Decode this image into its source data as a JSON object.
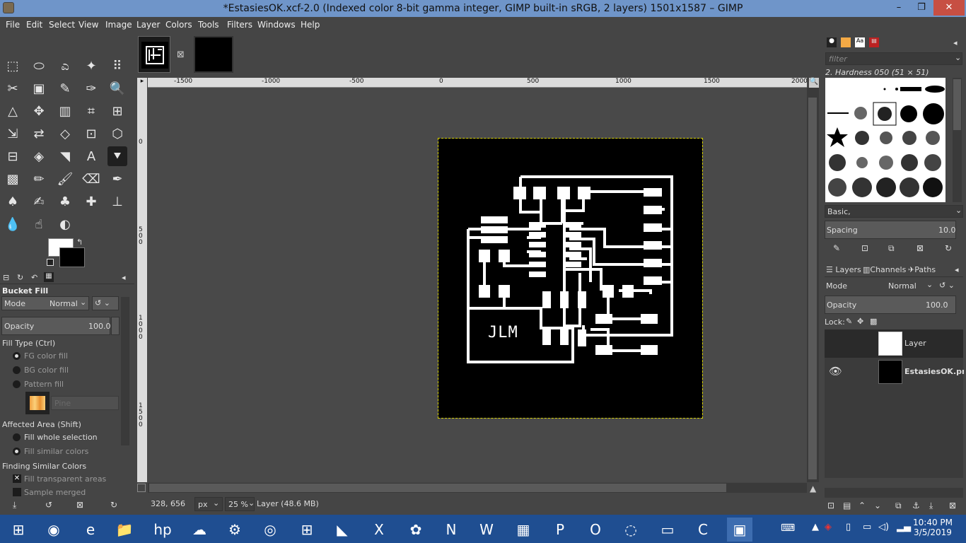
{
  "window": {
    "title": "*EstasiesOK.xcf-2.0 (Indexed color 8-bit gamma integer, GIMP built-in sRGB, 2 layers) 1501x1587 – GIMP",
    "minimize": "–",
    "maximize": "❐",
    "close": "✕"
  },
  "menu": [
    "File",
    "Edit",
    "Select",
    "View",
    "Image",
    "Layer",
    "Colors",
    "Tools",
    "Filters",
    "Windows",
    "Help"
  ],
  "toolbox": {
    "tools": [
      "rect-select",
      "ellipse-select",
      "free-select",
      "fuzzy-select",
      "color-select",
      "scissors",
      "foreground-select",
      "paths",
      "color-picker",
      "zoom",
      "measure",
      "move",
      "align",
      "crop",
      "unified-transform",
      "warp-transform",
      "flip",
      "perspective",
      "cage-transform",
      "3d-transform",
      "handle-transform",
      "warp",
      "smudge-like",
      "text",
      "bucket-fill",
      "gradient",
      "pencil",
      "paintbrush",
      "eraser",
      "airbrush",
      "ink",
      "mypaint-brush",
      "clone",
      "heal",
      "perspective-clone",
      "blur",
      "smudge",
      "dodge-burn"
    ],
    "icons": [
      "⬚",
      "⬭",
      "ಎ",
      "✦",
      "⠿",
      "✂",
      "▣",
      "✎",
      "✑",
      "🔍",
      "△",
      "✥",
      "▥",
      "⌗",
      "⊞",
      "⇲",
      "⇄",
      "◇",
      "⊡",
      "⬡",
      "⊟",
      "◈",
      "◥",
      "A",
      "⯆",
      "▩",
      "✏",
      "🖌",
      "⌫",
      "✒",
      "♠",
      "✍",
      "♣",
      "✚",
      "⊥",
      "💧",
      "☝",
      "◐"
    ],
    "fg_color": "#ffffff",
    "bg_color": "#000000"
  },
  "tool_options": {
    "title": "Bucket Fill",
    "mode_label": "Mode",
    "mode_value": "Normal",
    "opacity_label": "Opacity",
    "opacity_value": "100.0",
    "fill_type_label": "Fill Type  (Ctrl)",
    "fill_types": [
      "FG color fill",
      "BG color fill",
      "Pattern fill"
    ],
    "pattern_name": "Pine",
    "affected_label": "Affected Area  (Shift)",
    "affected": [
      "Fill whole selection",
      "Fill similar colors"
    ],
    "finding_label": "Finding Similar Colors",
    "finding_opts": [
      "Fill transparent areas",
      "Sample merged"
    ]
  },
  "ruler": {
    "h_ticks": [
      "-1500",
      "-1000",
      "-500",
      "0",
      "500",
      "1000",
      "1500",
      "2000"
    ],
    "v_ticks": [
      "0",
      "500",
      "1000",
      "1500"
    ]
  },
  "canvas": {
    "pcb_label": "JLM"
  },
  "status": {
    "coords": "328, 656",
    "unit": "px",
    "zoom": "25 %",
    "layer_info": "Layer (48.6 MB)"
  },
  "brushes": {
    "filter_placeholder": "filter",
    "brush_name": "2. Hardness 050 (51 × 51)",
    "preset": "Basic,",
    "spacing_label": "Spacing",
    "spacing_value": "10.0"
  },
  "layers": {
    "tabs": [
      "Layers",
      "Channels",
      "Paths"
    ],
    "mode_label": "Mode",
    "mode_value": "Normal",
    "opacity_label": "Opacity",
    "opacity_value": "100.0",
    "lock_label": "Lock:",
    "items": [
      {
        "name": "Layer"
      },
      {
        "name": "EstasiesOK.png"
      }
    ]
  },
  "taskbar": {
    "time": "10:40 PM",
    "date": "3/5/2019",
    "apps": [
      "⊞",
      "◉",
      "e",
      "📁",
      "hp",
      "☁",
      "⚙",
      "◎",
      "⊞",
      "◣",
      "X",
      "✿",
      "N",
      "W",
      "▦",
      "P",
      "O",
      "◌",
      "▭",
      "C",
      "▣"
    ]
  }
}
